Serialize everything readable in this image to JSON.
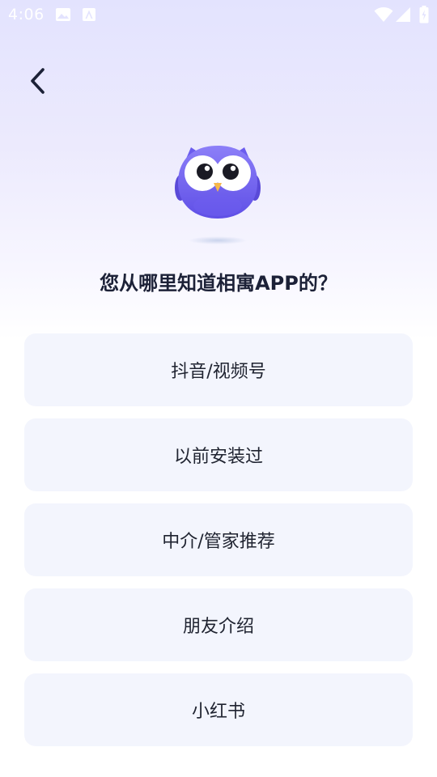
{
  "status_bar": {
    "time": "4:06",
    "icons": [
      "image-icon",
      "app-notification-icon",
      "wifi-icon",
      "signal-icon",
      "battery-charging-icon"
    ]
  },
  "header": {
    "back_icon": "chevron-left-icon"
  },
  "mascot": {
    "name": "owl-mascot",
    "body_color": "#7263f2"
  },
  "question": "您从哪里知道相寓APP的？",
  "options": [
    {
      "label": "抖音/视频号"
    },
    {
      "label": "以前安装过"
    },
    {
      "label": "中介/管家推荐"
    },
    {
      "label": "朋友介绍"
    },
    {
      "label": "小红书"
    }
  ],
  "colors": {
    "background_top": "#e3e3fe",
    "option_bg": "#f3f5fd",
    "text_dark": "#1c2137",
    "accent": "#7263f2"
  }
}
